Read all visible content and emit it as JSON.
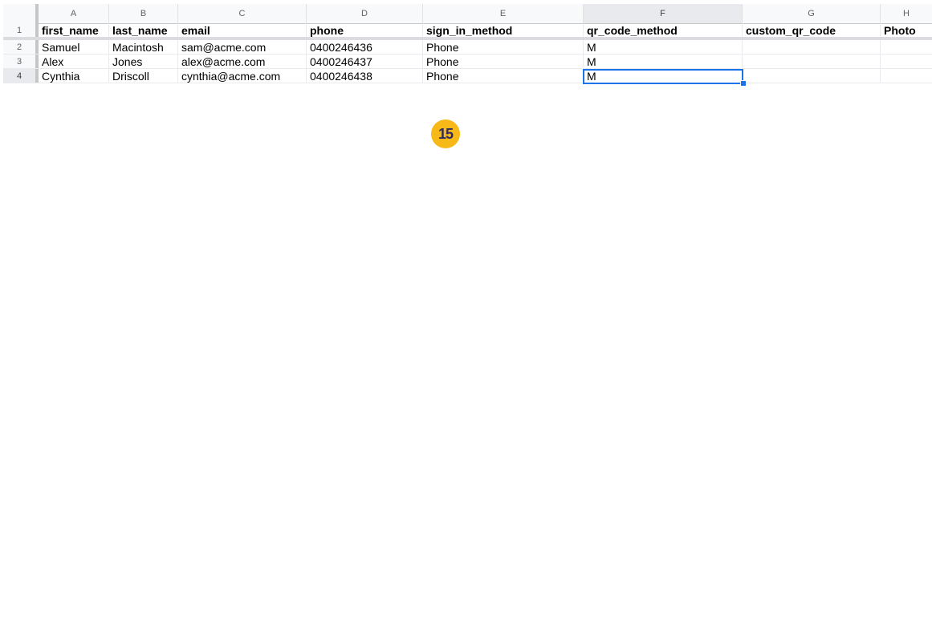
{
  "spreadsheet": {
    "column_letters": [
      "A",
      "B",
      "C",
      "D",
      "E",
      "F",
      "G",
      "H"
    ],
    "row_numbers": [
      "1",
      "2",
      "3",
      "4"
    ],
    "headers": [
      "first_name",
      "last_name",
      "email",
      "phone",
      "sign_in_method",
      "qr_code_method",
      "custom_qr_code",
      "Photo"
    ],
    "rows": [
      [
        "Samuel",
        "Macintosh",
        "sam@acme.com",
        "0400246436",
        "Phone",
        "M",
        "",
        ""
      ],
      [
        "Alex",
        "Jones",
        "alex@acme.com",
        "0400246437",
        "Phone",
        "M",
        "",
        ""
      ],
      [
        "Cynthia",
        "Driscoll",
        "cynthia@acme.com",
        "0400246438",
        "Phone",
        "M",
        "",
        ""
      ]
    ],
    "selected_cell": "F4",
    "selected_column": "F",
    "selected_row": "4"
  },
  "step_badge": {
    "label": "15",
    "color": "#f7b918"
  },
  "colors": {
    "selection": "#1a73e8",
    "header_bg": "#f8f9fa"
  }
}
